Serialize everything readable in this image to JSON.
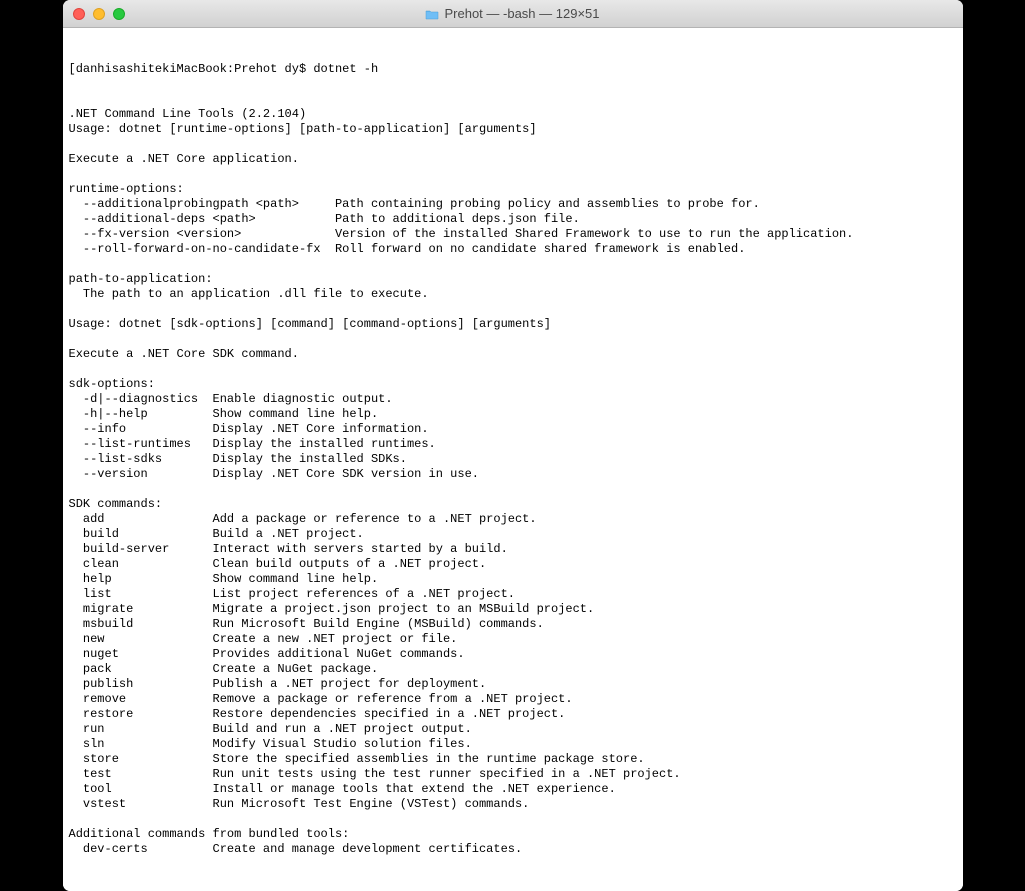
{
  "titlebar": {
    "title": "Prehot — -bash — 129×51"
  },
  "terminal": {
    "prompt": "[danhisashitekiMacBook:Prehot dy$ dotnet -h",
    "lines": [
      ".NET Command Line Tools (2.2.104)",
      "Usage: dotnet [runtime-options] [path-to-application] [arguments]",
      "",
      "Execute a .NET Core application.",
      "",
      "runtime-options:",
      "  --additionalprobingpath <path>     Path containing probing policy and assemblies to probe for.",
      "  --additional-deps <path>           Path to additional deps.json file.",
      "  --fx-version <version>             Version of the installed Shared Framework to use to run the application.",
      "  --roll-forward-on-no-candidate-fx  Roll forward on no candidate shared framework is enabled.",
      "",
      "path-to-application:",
      "  The path to an application .dll file to execute.",
      "",
      "Usage: dotnet [sdk-options] [command] [command-options] [arguments]",
      "",
      "Execute a .NET Core SDK command.",
      "",
      "sdk-options:",
      "  -d|--diagnostics  Enable diagnostic output.",
      "  -h|--help         Show command line help.",
      "  --info            Display .NET Core information.",
      "  --list-runtimes   Display the installed runtimes.",
      "  --list-sdks       Display the installed SDKs.",
      "  --version         Display .NET Core SDK version in use.",
      "",
      "SDK commands:",
      "  add               Add a package or reference to a .NET project.",
      "  build             Build a .NET project.",
      "  build-server      Interact with servers started by a build.",
      "  clean             Clean build outputs of a .NET project.",
      "  help              Show command line help.",
      "  list              List project references of a .NET project.",
      "  migrate           Migrate a project.json project to an MSBuild project.",
      "  msbuild           Run Microsoft Build Engine (MSBuild) commands.",
      "  new               Create a new .NET project or file.",
      "  nuget             Provides additional NuGet commands.",
      "  pack              Create a NuGet package.",
      "  publish           Publish a .NET project for deployment.",
      "  remove            Remove a package or reference from a .NET project.",
      "  restore           Restore dependencies specified in a .NET project.",
      "  run               Build and run a .NET project output.",
      "  sln               Modify Visual Studio solution files.",
      "  store             Store the specified assemblies in the runtime package store.",
      "  test              Run unit tests using the test runner specified in a .NET project.",
      "  tool              Install or manage tools that extend the .NET experience.",
      "  vstest            Run Microsoft Test Engine (VSTest) commands.",
      "",
      "Additional commands from bundled tools:",
      "  dev-certs         Create and manage development certificates."
    ]
  }
}
